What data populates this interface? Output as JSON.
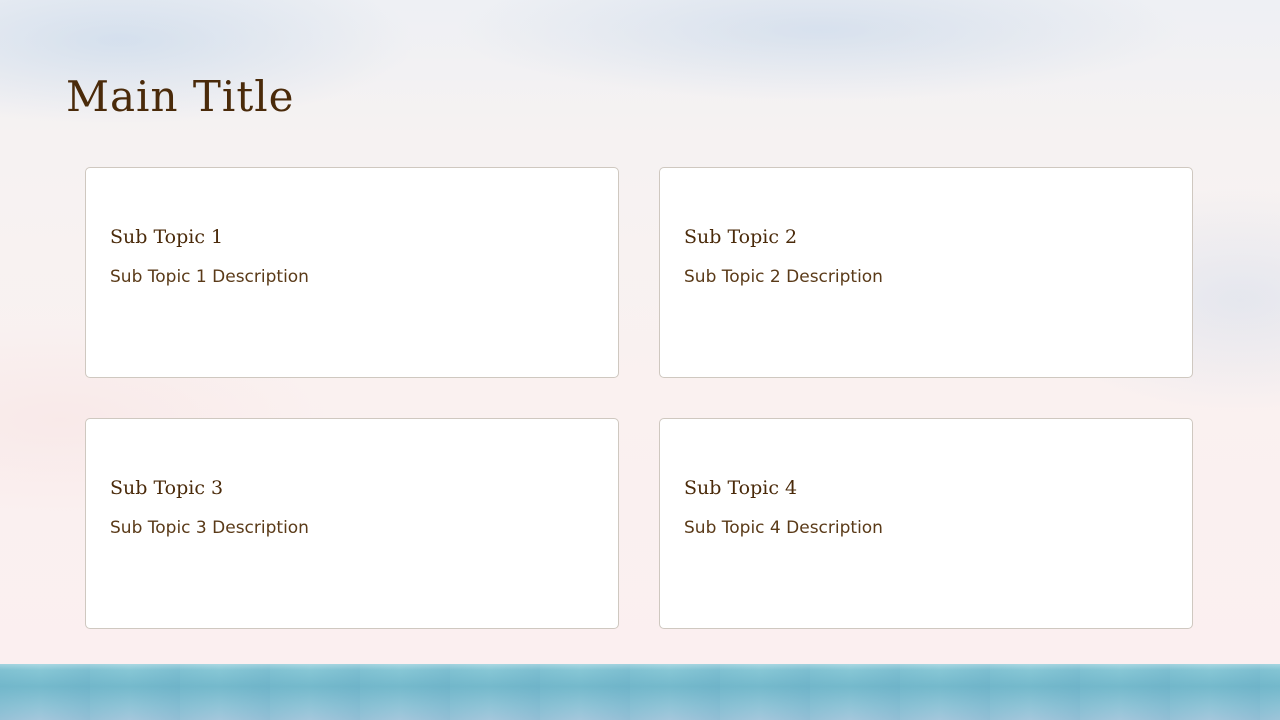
{
  "slide": {
    "title": "Main Title",
    "colors": {
      "title_text": "#4a2a0a",
      "body_text": "#5a3a18",
      "card_background": "#ffffff",
      "card_border": "#cfc8c0",
      "background_top": "#eef0f4",
      "background_bottom": "#fbeff0",
      "sea": "#6fb6c9"
    },
    "cards": [
      {
        "title": "Sub Topic 1",
        "description": "Sub Topic 1 Description"
      },
      {
        "title": "Sub Topic 2",
        "description": "Sub Topic 2 Description"
      },
      {
        "title": "Sub Topic 3",
        "description": "Sub Topic 3 Description"
      },
      {
        "title": "Sub Topic 4",
        "description": "Sub Topic 4 Description"
      }
    ]
  }
}
